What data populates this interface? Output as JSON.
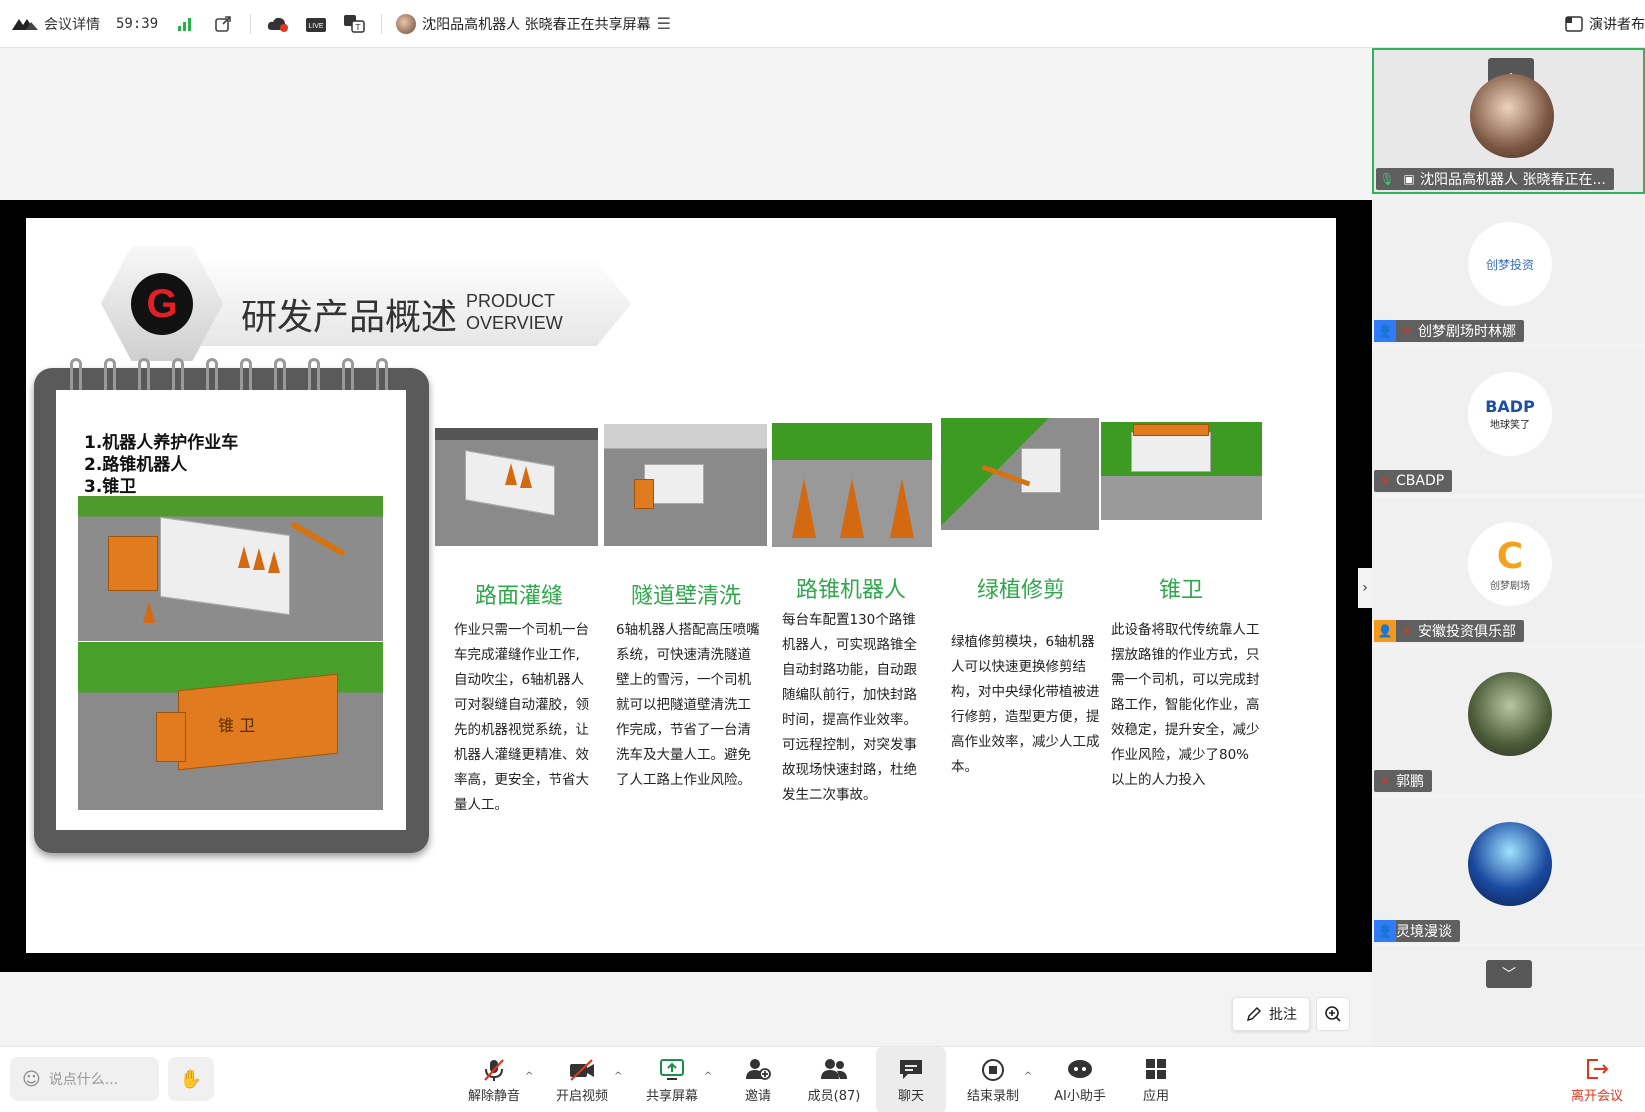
{
  "topbar": {
    "meeting_details": "会议详情",
    "timer": "59:39",
    "live_badge": "LIVE",
    "share_status": "沈阳品高机器人 张晓春正在共享屏幕",
    "presenter_view": "演讲者布"
  },
  "slide": {
    "logo_letter": "G",
    "title": "研发产品概述",
    "title_en_line1": "PRODUCT",
    "title_en_line2": "OVERVIEW",
    "list": [
      "1.机器人养护作业车",
      "2.路锥机器人",
      "3.锥卫"
    ],
    "truck_label": "锥 卫",
    "columns": [
      {
        "title": "路面灌缝",
        "text": "作业只需一个司机一台车完成灌缝作业工作,自动吹尘，6轴机器人可对裂缝自动灌胶，领先的机器视觉系统，让机器人灌缝更精准、效率高，更安全，节省大量人工。"
      },
      {
        "title": "隧道壁清洗",
        "text": "6轴机器人搭配高压喷嘴系统，可快速清洗隧道壁上的雪污，一个司机就可以把隧道壁清洗工作完成，节省了一台清洗车及大量人工。避免了人工路上作业风险。"
      },
      {
        "title": "路锥机器人",
        "text": "每台车配置130个路锥机器人，可实现路锥全自动封路功能，自动跟随编队前行，加快封路时间，提高作业效率。可远程控制，对突发事故现场快速封路，杜绝发生二次事故。"
      },
      {
        "title": "绿植修剪",
        "text": "绿植修剪模块，6轴机器人可以快速更换修剪结构，对中央绿化带植被进行修剪，造型更方便，提高作业效率，减少人工成本。"
      },
      {
        "title": "锥卫",
        "text": "此设备将取代传统靠人工摆放路锥的作业方式，只需一个司机，可以完成封路工作，智能化作业，高效稳定，提升安全，减少作业风险，减少了80%以上的人力投入"
      }
    ]
  },
  "participants": [
    {
      "name": "沈阳品高机器人 张晓春正在...",
      "role": "host-sharing"
    },
    {
      "name": "创梦剧场时林娜",
      "role": "member",
      "avatar_text": "创梦投资"
    },
    {
      "name": "CBADP",
      "role": "member",
      "avatar_text": "BADP",
      "avatar_sub": "地球笑了"
    },
    {
      "name": "安徽投资俱乐部",
      "role": "admin",
      "avatar_text": "创梦剧场"
    },
    {
      "name": "郭鹏",
      "role": "member"
    },
    {
      "name": "灵境漫谈",
      "role": "member"
    }
  ],
  "annotate": {
    "label": "批注"
  },
  "bottombar": {
    "chat_placeholder": "说点什么...",
    "controls": [
      {
        "label": "解除静音",
        "icon": "mic-off-icon"
      },
      {
        "label": "开启视频",
        "icon": "camera-off-icon"
      },
      {
        "label": "共享屏幕",
        "icon": "share-screen-icon"
      },
      {
        "label": "邀请",
        "icon": "invite-icon"
      },
      {
        "label": "成员(87)",
        "icon": "members-icon"
      },
      {
        "label": "聊天",
        "icon": "chat-icon"
      },
      {
        "label": "结束录制",
        "icon": "record-stop-icon"
      },
      {
        "label": "AI小助手",
        "icon": "ai-assistant-icon"
      },
      {
        "label": "应用",
        "icon": "apps-icon"
      }
    ],
    "leave": "离开会议"
  },
  "colors": {
    "accent_green": "#2ea84b",
    "leave_red": "#e0361f",
    "active_border": "#2db55d"
  }
}
